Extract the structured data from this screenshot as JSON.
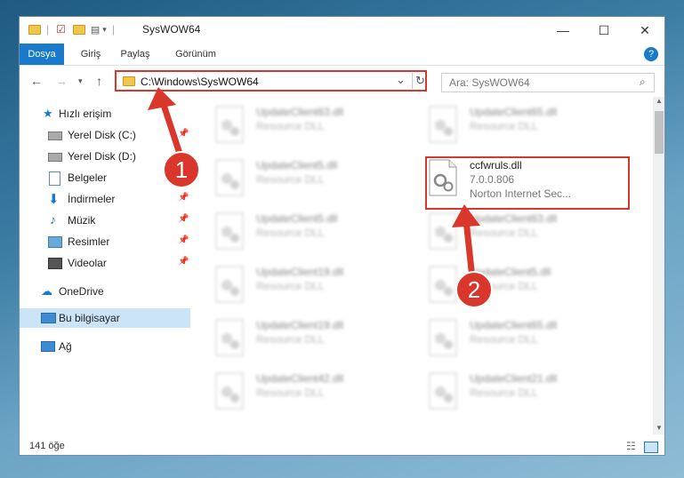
{
  "window": {
    "title": "SysWOW64",
    "controls": {
      "minimize": "—",
      "maximize": "☐",
      "close": "✕"
    }
  },
  "ribbon": {
    "tabs": [
      "Dosya",
      "Giriş",
      "Paylaş",
      "Görünüm"
    ],
    "active": 0,
    "help": "?"
  },
  "address": {
    "path": "C:\\Windows\\SysWOW64",
    "refresh": "↻",
    "dropdown": "⌄"
  },
  "search": {
    "placeholder": "Ara: SysWOW64"
  },
  "nav": {
    "quick_access": "Hızlı erişim",
    "items": [
      "Yerel Disk (C:)",
      "Yerel Disk (D:)",
      "Belgeler",
      "İndirmeler",
      "Müzik",
      "Resimler",
      "Videolar"
    ],
    "onedrive": "OneDrive",
    "this_pc": "Bu bilgisayar",
    "network": "Ağ"
  },
  "files": {
    "left": [
      {
        "name": "UpdateClient63.dll",
        "desc": "Resource DLL"
      },
      {
        "name": "UpdateClient5.dll",
        "desc": "Resource DLL"
      },
      {
        "name": "UpdateClient5.dll",
        "desc": "Resource DLL"
      },
      {
        "name": "UpdateClient19.dll",
        "desc": "Resource DLL"
      },
      {
        "name": "UpdateClient19.dll",
        "desc": "Resource DLL"
      },
      {
        "name": "UpdateClient42.dll",
        "desc": "Resource DLL"
      }
    ],
    "right": [
      {
        "name": "UpdateClient65.dll",
        "desc": "Resource DLL"
      },
      {
        "name": "UpdateClient63.dll",
        "desc": "Resource DLL"
      },
      {
        "name": "UpdateClient5.dll",
        "desc": "Resource DLL"
      },
      {
        "name": "UpdateClient65.dll",
        "desc": "Resource DLL"
      },
      {
        "name": "UpdateClient21.dll",
        "desc": "Resource DLL"
      }
    ],
    "highlighted": {
      "name": "ccfwruls.dll",
      "version": "7.0.0.806",
      "desc": "Norton Internet Sec..."
    }
  },
  "status": {
    "count": "141 öğe"
  },
  "annotations": {
    "badge1": "1",
    "badge2": "2",
    "color": "#d9362c"
  }
}
